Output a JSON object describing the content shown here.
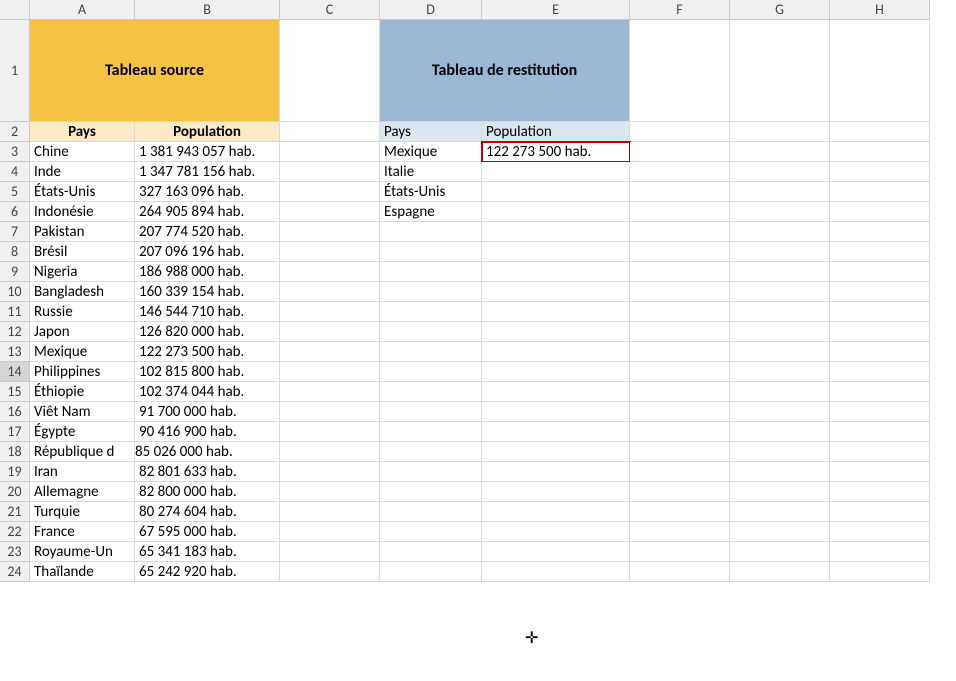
{
  "columns": [
    "A",
    "B",
    "C",
    "D",
    "E",
    "F",
    "G",
    "H"
  ],
  "rows": [
    1,
    2,
    3,
    4,
    5,
    6,
    7,
    8,
    9,
    10,
    11,
    12,
    13,
    14,
    15,
    16,
    17,
    18,
    19,
    20,
    21,
    22,
    23,
    24
  ],
  "title_source": "Tableau source",
  "title_restitution": "Tableau de restitution",
  "headers_source": {
    "pays": "Pays",
    "population": "Population"
  },
  "headers_restitution": {
    "pays": "Pays",
    "population": "Population"
  },
  "source_data": [
    {
      "pays": "Chine",
      "pop": "1 381 943 057 hab."
    },
    {
      "pays": "Inde",
      "pop": "1 347 781 156 hab."
    },
    {
      "pays": "États-Unis",
      "pop": "327 163 096 hab."
    },
    {
      "pays": "Indonésie",
      "pop": "264 905 894 hab."
    },
    {
      "pays": "Pakistan",
      "pop": "207 774 520 hab."
    },
    {
      "pays": "Brésil",
      "pop": "207 096 196 hab."
    },
    {
      "pays": "Nigeria",
      "pop": "186 988 000 hab."
    },
    {
      "pays": "Bangladesh",
      "pop": "160 339 154 hab."
    },
    {
      "pays": "Russie",
      "pop": "146 544 710 hab."
    },
    {
      "pays": "Japon",
      "pop": "126 820 000 hab."
    },
    {
      "pays": "Mexique",
      "pop": "122 273 500 hab."
    },
    {
      "pays": "Philippines",
      "pop": "102 815 800 hab."
    },
    {
      "pays": "Éthiopie",
      "pop": "102 374 044 hab."
    },
    {
      "pays": "Viêt Nam",
      "pop": "91 700 000 hab."
    },
    {
      "pays": "Égypte",
      "pop": "90 416 900 hab."
    },
    {
      "pays": "République d",
      "pop": "85 026 000 hab."
    },
    {
      "pays": "Iran",
      "pop": "82 801 633 hab."
    },
    {
      "pays": "Allemagne",
      "pop": "82 800 000 hab."
    },
    {
      "pays": "Turquie",
      "pop": "80 274 604 hab."
    },
    {
      "pays": "France",
      "pop": "67 595 000 hab."
    },
    {
      "pays": "Royaume-Un",
      "pop": "65 341 183 hab."
    },
    {
      "pays": "Thaïlande",
      "pop": "65 242 920 hab."
    }
  ],
  "restitution_data": [
    {
      "pays": "Mexique",
      "pop": "122 273 500 hab."
    },
    {
      "pays": "Italie",
      "pop": ""
    },
    {
      "pays": "États-Unis",
      "pop": ""
    },
    {
      "pays": "Espagne",
      "pop": ""
    }
  ],
  "selected_row_header": 14,
  "highlighted_cell": "E3",
  "cursor_glyph": "✛"
}
